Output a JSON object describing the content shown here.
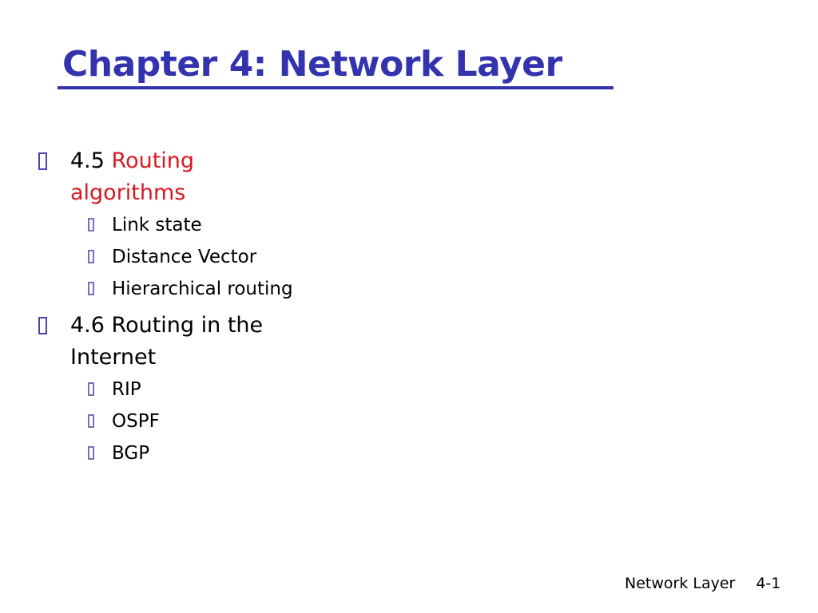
{
  "slide": {
    "title": "Chapter 4: Network Layer",
    "title_color": "#3333ad",
    "accent_color": "#d71920",
    "background_color": "#ffffff",
    "bullet_color_level1": "#4646ac",
    "bullet_color_level2": "#7272bb"
  },
  "outline": [
    {
      "number": "4.5 ",
      "label": "Routing algorithms",
      "label_highlighted": true,
      "bullet": "missing-glyph-box",
      "children": [
        {
          "label": "Link state",
          "bullet": "missing-glyph-box"
        },
        {
          "label": "Distance Vector",
          "bullet": "missing-glyph-box"
        },
        {
          "label": "Hierarchical routing",
          "bullet": "missing-glyph-box"
        }
      ]
    },
    {
      "number": "4.6 ",
      "label": "Routing in the Internet",
      "label_highlighted": false,
      "bullet": "missing-glyph-box",
      "children": [
        {
          "label": "RIP",
          "bullet": "missing-glyph-box"
        },
        {
          "label": "OSPF",
          "bullet": "missing-glyph-box"
        },
        {
          "label": "BGP",
          "bullet": "missing-glyph-box"
        }
      ]
    }
  ],
  "footer": {
    "label": "Network Layer",
    "page": "4-1"
  }
}
